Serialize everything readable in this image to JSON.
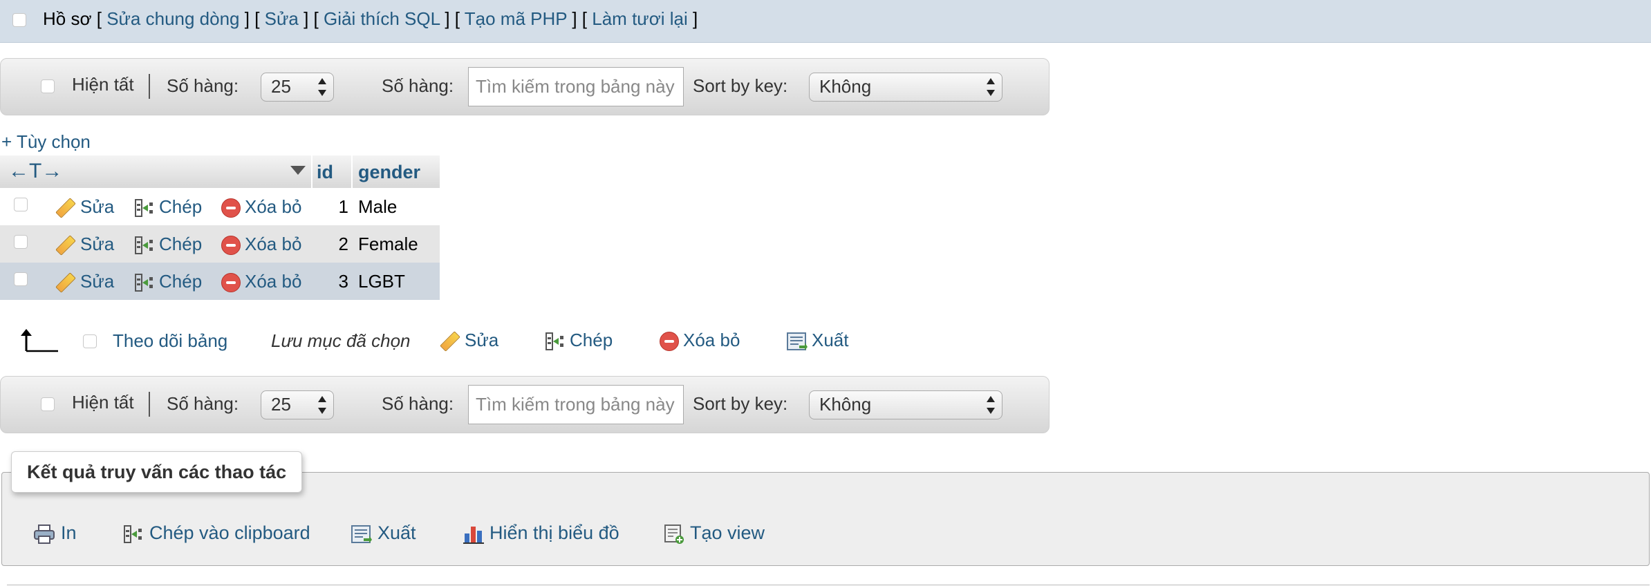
{
  "profiling": {
    "label": "Hồ sơ",
    "links": [
      "Sửa chung dòng",
      "Sửa",
      "Giải thích SQL",
      "Tạo mã PHP",
      "Làm tươi lại"
    ]
  },
  "navigation": {
    "show_all": "Hiện tất",
    "rows_label": "Số hàng:",
    "rows_value": "25",
    "filter_label": "Số hàng:",
    "search_placeholder": "Tìm kiếm trong bảng này",
    "sort_label": "Sort by key:",
    "sort_value": "Không"
  },
  "options_link": "+ Tùy chọn",
  "table": {
    "arrows": "←T→",
    "columns": [
      "id",
      "gender"
    ],
    "actions": {
      "edit": "Sửa",
      "copy": "Chép",
      "delete": "Xóa bỏ"
    },
    "rows": [
      {
        "id": "1",
        "gender": "Male"
      },
      {
        "id": "2",
        "gender": "Female"
      },
      {
        "id": "3",
        "gender": "LGBT"
      }
    ]
  },
  "bulk": {
    "watch_table": "Theo dõi bảng",
    "with_selected": "Lưu mục đã chọn",
    "edit": "Sửa",
    "copy": "Chép",
    "delete": "Xóa bỏ",
    "export": "Xuất"
  },
  "query_results": {
    "legend": "Kết quả truy vấn các thao tác",
    "operations": [
      "In",
      "Chép vào clipboard",
      "Xuất",
      "Hiển thị biểu đồ",
      "Tạo view"
    ]
  },
  "colors": {
    "link": "#235a81",
    "profiling_bg": "#d4dee8",
    "row_even": "#e5e5e5",
    "row_selected": "#ced6df"
  }
}
